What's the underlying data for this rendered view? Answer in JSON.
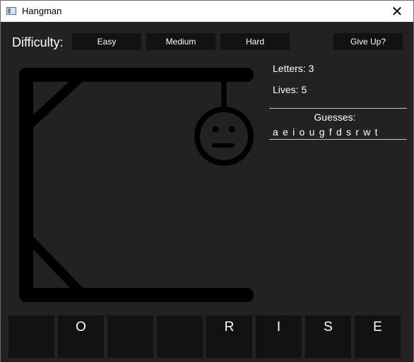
{
  "window": {
    "title": "Hangman",
    "icon": "app-window-icon",
    "close_glyph": "✕"
  },
  "toolbar": {
    "difficulty_label": "Difficulty:",
    "easy_label": "Easy",
    "medium_label": "Medium",
    "hard_label": "Hard",
    "give_up_label": "Give Up?"
  },
  "status": {
    "letters_text": "Letters: 3",
    "lives_text": "Lives: 5"
  },
  "guesses": {
    "title": "Guesses:",
    "list": "a e i o u g f d s r w t"
  },
  "word": {
    "tiles": [
      "",
      "O",
      "",
      "",
      "R",
      "I",
      "S",
      "E"
    ]
  },
  "colors": {
    "background": "#222222",
    "drawing": "#000000",
    "button_bg": "#121212",
    "text": "#ffffff"
  },
  "hangman": {
    "head_expression": "neutral"
  }
}
